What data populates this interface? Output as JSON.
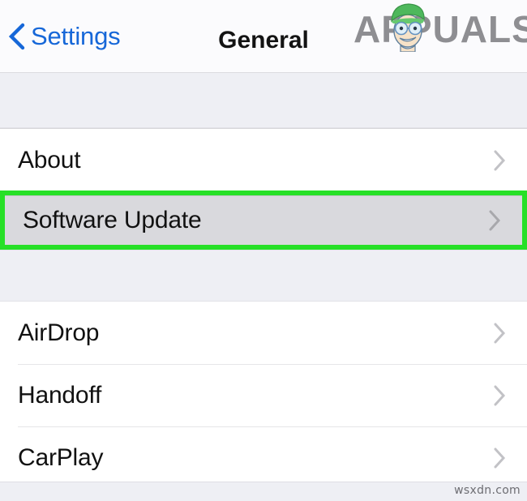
{
  "navbar": {
    "back_label": "Settings",
    "back_icon": "chevron-left-icon",
    "title": "General",
    "accent_color": "#1667d8",
    "title_color": "#131313"
  },
  "brand": {
    "wordmark": "APPUALS",
    "mascot_icon": "appuals-mascot-icon",
    "wordmark_color": "#8e8e92",
    "beret_color": "#4eb85c"
  },
  "list": {
    "sections": [
      {
        "name": "device-info-section",
        "rows": [
          {
            "label": "About",
            "chevron": "chevron-right-icon",
            "highlighted": false
          },
          {
            "label": "Software Update",
            "chevron": "chevron-right-icon",
            "highlighted": true
          }
        ]
      },
      {
        "name": "continuity-section",
        "rows": [
          {
            "label": "AirDrop",
            "chevron": "chevron-right-icon",
            "highlighted": false
          },
          {
            "label": "Handoff",
            "chevron": "chevron-right-icon",
            "highlighted": false
          },
          {
            "label": "CarPlay",
            "chevron": "chevron-right-icon",
            "highlighted": false
          }
        ]
      }
    ]
  },
  "highlight": {
    "border_color": "#27e027",
    "fill_color": "#d9d9dd"
  },
  "footer": {
    "watermark": "wsxdn.com"
  }
}
